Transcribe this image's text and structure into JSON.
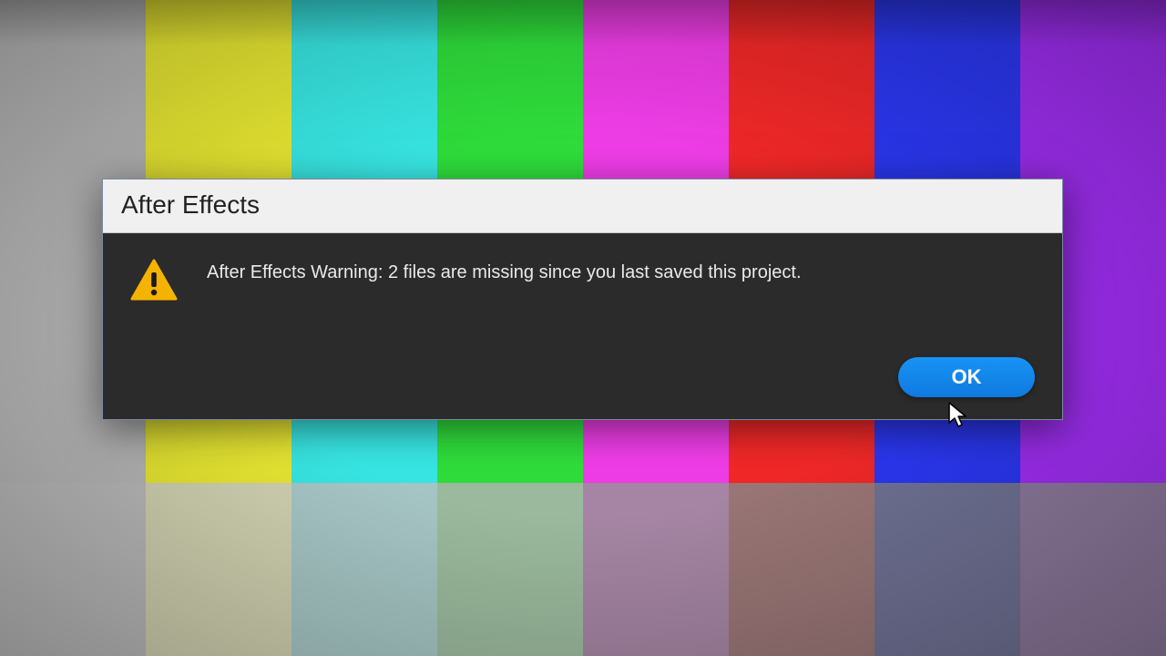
{
  "background": {
    "bars": [
      "#b7b7b7",
      "#e7e733",
      "#38e5e2",
      "#2fdc3b",
      "#ee3de6",
      "#f02828",
      "#2b37f0",
      "#9f2ef2"
    ]
  },
  "dialog": {
    "title": "After Effects",
    "message": "After Effects Warning: 2 files are missing since you last saved this project.",
    "ok_label": "OK",
    "icon": "warning-icon",
    "colors": {
      "accent": "#1280e6",
      "body_bg": "#2b2b2b",
      "title_bg": "#f0f0f0"
    }
  }
}
